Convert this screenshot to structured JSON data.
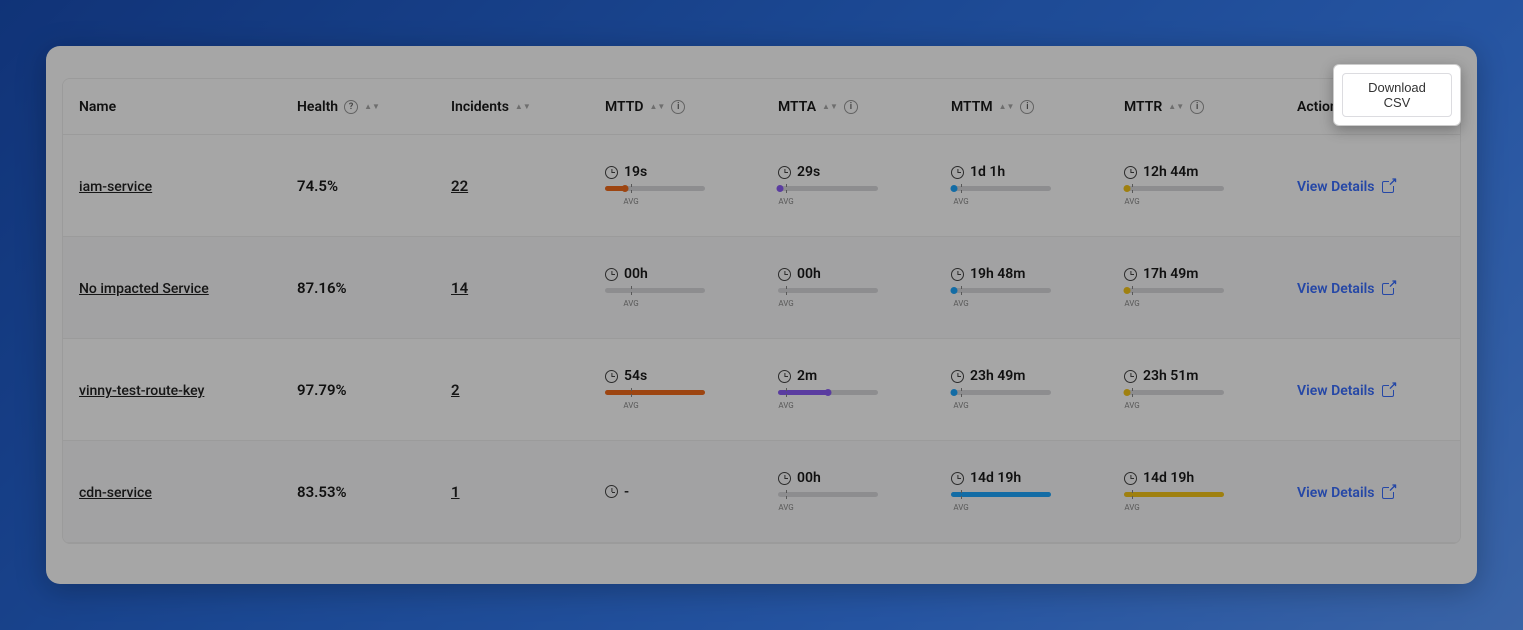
{
  "download_label": "Download CSV",
  "view_details_label": "View Details",
  "avg_label": "AVG",
  "columns": {
    "name": "Name",
    "health": "Health",
    "incidents": "Incidents",
    "mttd": "MTTD",
    "mtta": "MTTA",
    "mttm": "MTTM",
    "mttr": "MTTR",
    "actions": "Actions"
  },
  "rows": [
    {
      "name": "iam-service",
      "health": "74.5%",
      "incidents": "22",
      "mttd": {
        "value": "19s",
        "fill_pct": 20,
        "dot_pct": 20,
        "marker_pct": 26,
        "color": "c-orange"
      },
      "mtta": {
        "value": "29s",
        "fill_pct": 0,
        "dot_pct": 2,
        "marker_pct": 8,
        "color": "c-purple"
      },
      "mttm": {
        "value": "1d 1h",
        "fill_pct": 0,
        "dot_pct": 3,
        "marker_pct": 10,
        "color": "c-blue"
      },
      "mttr": {
        "value": "12h 44m",
        "fill_pct": 0,
        "dot_pct": 3,
        "marker_pct": 8,
        "color": "c-yellow"
      }
    },
    {
      "name": "No impacted Service",
      "health": "87.16%",
      "incidents": "14",
      "mttd": {
        "value": "00h",
        "fill_pct": 0,
        "dot_pct": null,
        "marker_pct": 26,
        "color": "c-orange"
      },
      "mtta": {
        "value": "00h",
        "fill_pct": 0,
        "dot_pct": null,
        "marker_pct": 8,
        "color": "c-purple"
      },
      "mttm": {
        "value": "19h 48m",
        "fill_pct": 0,
        "dot_pct": 3,
        "marker_pct": 10,
        "color": "c-blue"
      },
      "mttr": {
        "value": "17h 49m",
        "fill_pct": 0,
        "dot_pct": 3,
        "marker_pct": 8,
        "color": "c-yellow"
      }
    },
    {
      "name": "vinny-test-route-key",
      "health": "97.79%",
      "incidents": "2",
      "mttd": {
        "value": "54s",
        "fill_pct": 100,
        "dot_pct": null,
        "marker_pct": 26,
        "color": "c-orange"
      },
      "mtta": {
        "value": "2m",
        "fill_pct": 50,
        "dot_pct": 50,
        "marker_pct": 8,
        "color": "c-purple"
      },
      "mttm": {
        "value": "23h 49m",
        "fill_pct": 0,
        "dot_pct": 3,
        "marker_pct": 10,
        "color": "c-blue"
      },
      "mttr": {
        "value": "23h 51m",
        "fill_pct": 0,
        "dot_pct": 3,
        "marker_pct": 8,
        "color": "c-yellow"
      }
    },
    {
      "name": "cdn-service",
      "health": "83.53%",
      "incidents": "1",
      "mttd": {
        "value": "-",
        "fill_pct": null,
        "dot_pct": null,
        "marker_pct": null,
        "color": "c-orange"
      },
      "mtta": {
        "value": "00h",
        "fill_pct": 0,
        "dot_pct": null,
        "marker_pct": 8,
        "color": "c-purple"
      },
      "mttm": {
        "value": "14d 19h",
        "fill_pct": 100,
        "dot_pct": null,
        "marker_pct": 10,
        "color": "c-blue"
      },
      "mttr": {
        "value": "14d 19h",
        "fill_pct": 100,
        "dot_pct": null,
        "marker_pct": 8,
        "color": "c-yellow"
      }
    }
  ]
}
